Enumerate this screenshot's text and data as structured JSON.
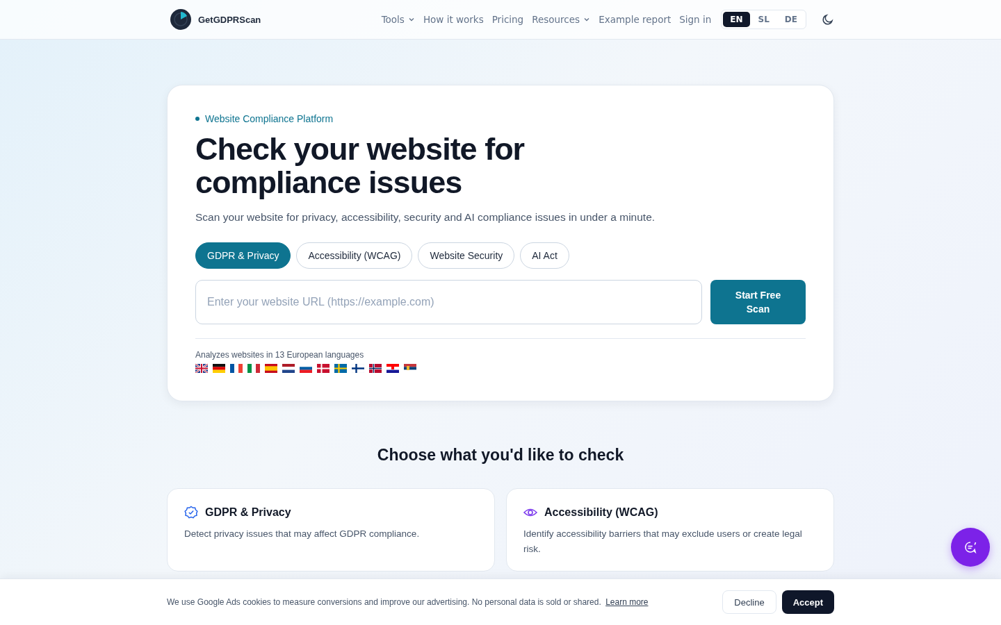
{
  "header": {
    "brand": "GetGDPRScan",
    "nav": [
      {
        "label": "Tools",
        "dropdown": true
      },
      {
        "label": "How it works",
        "dropdown": false
      },
      {
        "label": "Pricing",
        "dropdown": false
      },
      {
        "label": "Resources",
        "dropdown": true
      },
      {
        "label": "Example report",
        "dropdown": false
      },
      {
        "label": "Sign in",
        "dropdown": false
      }
    ],
    "languages": [
      {
        "label": "EN",
        "selected": true
      },
      {
        "label": "SL",
        "selected": false
      },
      {
        "label": "DE",
        "selected": false
      }
    ]
  },
  "hero": {
    "eyebrow": "Website Compliance Platform",
    "title": "Check your website for compliance issues",
    "subtitle": "Scan your website for privacy, accessibility, security and AI compliance issues in under a minute.",
    "tabs": [
      {
        "label": "GDPR & Privacy",
        "selected": true
      },
      {
        "label": "Accessibility (WCAG)",
        "selected": false
      },
      {
        "label": "Website Security",
        "selected": false
      },
      {
        "label": "AI Act",
        "selected": false
      }
    ],
    "url_field": {
      "placeholder": "Enter your website URL (https://example.com)"
    },
    "scan_button": "Start Free Scan",
    "languages_note": "Analyzes websites in 13 European languages"
  },
  "checks": {
    "title": "Choose what you'd like to check",
    "cards": [
      {
        "kind": "shield",
        "title": "GDPR & Privacy",
        "description": "Detect privacy issues that may affect GDPR compliance."
      },
      {
        "kind": "eye",
        "title": "Accessibility (WCAG)",
        "description": "Identify accessibility barriers that may exclude users or create legal risk."
      }
    ]
  },
  "cookie_bar": {
    "text": "We use Google Ads cookies to measure conversions and improve our advertising. No personal data is sold or shared.",
    "link": "Learn more",
    "buttons": [
      {
        "label": "Decline",
        "kind": "secondary"
      },
      {
        "label": "Accept",
        "kind": "primary"
      }
    ]
  }
}
